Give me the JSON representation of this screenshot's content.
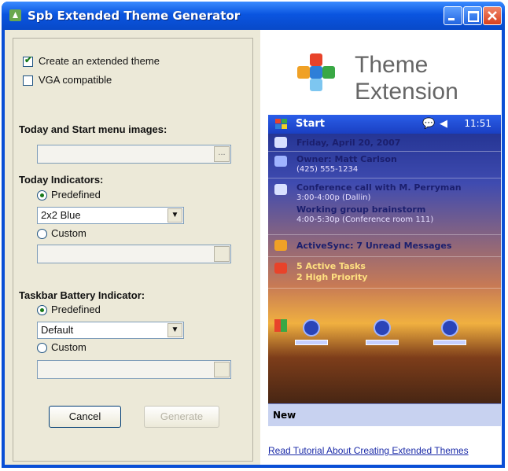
{
  "window": {
    "title": "Spb Extended Theme Generator",
    "colors": {
      "titlebar": "#0a55e0",
      "panel": "#ece9d8"
    }
  },
  "options": {
    "create_extended_theme": {
      "label": "Create an extended theme",
      "checked": true
    },
    "vga_compatible": {
      "label": "VGA compatible",
      "checked": false
    }
  },
  "today_images": {
    "heading": "Today and Start menu images:",
    "value": ""
  },
  "today_indicators": {
    "heading": "Today Indicators:",
    "predefined_label": "Predefined",
    "selected": "2x2 Blue",
    "custom_label": "Custom",
    "custom_value": ""
  },
  "battery_indicator": {
    "heading": "Taskbar Battery Indicator:",
    "predefined_label": "Predefined",
    "selected": "Default",
    "custom_label": "Custom",
    "custom_value": ""
  },
  "buttons": {
    "cancel": "Cancel",
    "generate": "Generate"
  },
  "preview": {
    "logo_line1": "Theme",
    "logo_line2": "Extension",
    "start_label": "Start",
    "time": "11:51",
    "date": "Friday, April 20, 2007",
    "owner": "Owner: Matt Carlson",
    "phone": "(425) 555-1234",
    "appt1_title": "Conference call with M. Perryman",
    "appt1_detail": "3:00-4:00p (Dallin)",
    "appt2_title": "Working group brainstorm",
    "appt2_detail": "4:00-5:30p (Conference room 111)",
    "activesync": "ActiveSync: 7 Unread Messages",
    "tasks": "5 Active Tasks",
    "tasks_priority": "2 High Priority",
    "softkey": "New",
    "tutorial_link": "Read Tutorial About Creating Extended Themes"
  }
}
